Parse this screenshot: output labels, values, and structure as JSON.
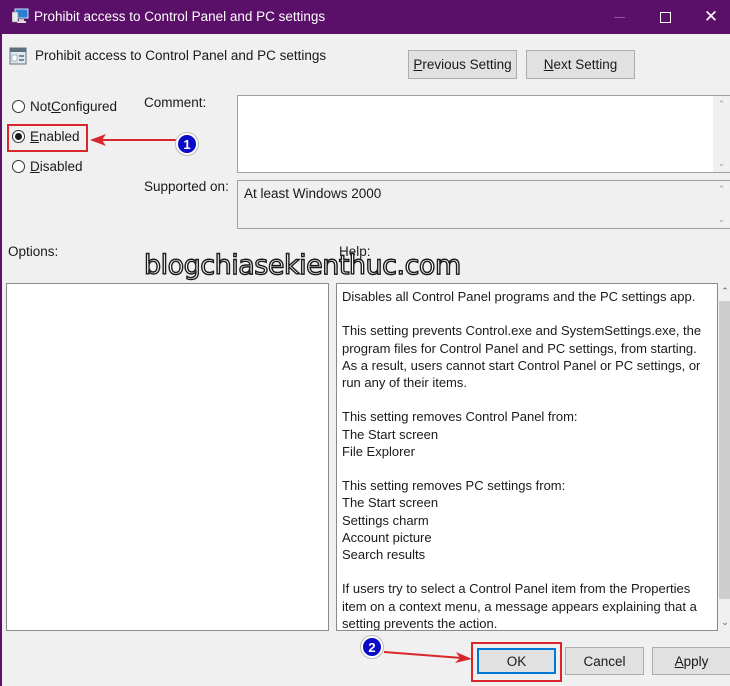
{
  "window": {
    "title": "Prohibit access to Control Panel and PC settings",
    "controls": {
      "minimize": "minimize",
      "maximize": "maximize",
      "close": "✕"
    },
    "theme_color": "#5a0f68"
  },
  "header": {
    "policy_name": "Prohibit access to Control Panel and PC settings",
    "prev_button": {
      "accel": "P",
      "rest": "revious Setting"
    },
    "next_button": {
      "accel": "N",
      "rest": "ext Setting"
    }
  },
  "state": {
    "options": [
      {
        "id": "not_configured",
        "pre": "Not ",
        "accel": "C",
        "post": "onfigured",
        "selected": false
      },
      {
        "id": "enabled",
        "pre": "",
        "accel": "E",
        "post": "nabled",
        "selected": true
      },
      {
        "id": "disabled",
        "pre": "",
        "accel": "D",
        "post": "isabled",
        "selected": false
      }
    ]
  },
  "labels": {
    "comment": "Comment:",
    "supported_on": "Supported on:",
    "options": "Options:",
    "help": "Help:"
  },
  "fields": {
    "comment_value": "",
    "supported_on_value": "At least Windows 2000"
  },
  "help": {
    "paragraphs": [
      [
        "Disables all Control Panel programs and the PC settings app."
      ],
      [
        "This setting prevents Control.exe and SystemSettings.exe, the program files for Control Panel and PC settings, from starting. As a result, users cannot start Control Panel or PC settings, or run any of their items."
      ],
      [
        "This setting removes Control Panel from:",
        "The Start screen",
        "File Explorer"
      ],
      [
        "This setting removes PC settings from:",
        "The Start screen",
        "Settings charm",
        "Account picture",
        "Search results"
      ],
      [
        "If users try to select a Control Panel item from the Properties item on a context menu, a message appears explaining that a setting prevents the action."
      ]
    ],
    "scroll_position": 0
  },
  "footer": {
    "ok": "OK",
    "cancel": "Cancel",
    "apply": {
      "accel": "A",
      "rest": "pply"
    }
  },
  "annotations": {
    "watermark": "blogchiasekienthuc.com",
    "step1": "1",
    "step2": "2",
    "highlight_color": "#d9262c",
    "badge_color": "#0a0ac8"
  }
}
